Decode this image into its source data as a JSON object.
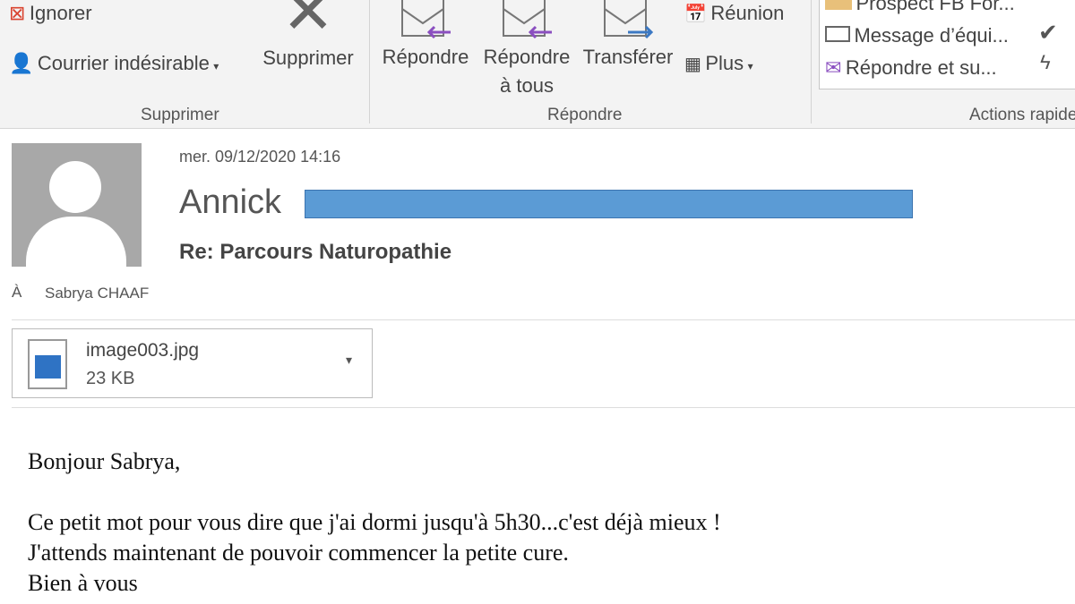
{
  "ribbon": {
    "ignore": "Ignorer",
    "junk": "Courrier indésirable",
    "delete": "Supprimer",
    "group_delete": "Supprimer",
    "reply": "Répondre",
    "reply_all_1": "Répondre",
    "reply_all_2": "à tous",
    "forward": "Transférer",
    "meeting": "Réunion",
    "more": "Plus",
    "group_reply": "Répondre",
    "quick_steps": [
      "Prospect FB For...",
      "Message d’équi...",
      "Répondre et su..."
    ],
    "group_quick": "Actions rapides"
  },
  "message": {
    "date": "mer. 09/12/2020 14:16",
    "sender": "Annick",
    "subject": "Re: Parcours Naturopathie",
    "to_label": "À",
    "to": "Sabrya CHAAF",
    "attachment": {
      "name": "image003.jpg",
      "size": "23 KB"
    },
    "body": [
      "Bonjour Sabrya,",
      "Ce petit mot pour vous dire que j'ai dormi jusqu'à 5h30...c'est déjà mieux !",
      "J'attends maintenant de pouvoir commencer la petite cure.",
      "Bien à vous"
    ]
  },
  "colors": {
    "redaction": "#5b9bd5",
    "reply_arrow": "#8b4fc0",
    "forward_arrow": "#3b78c3"
  }
}
